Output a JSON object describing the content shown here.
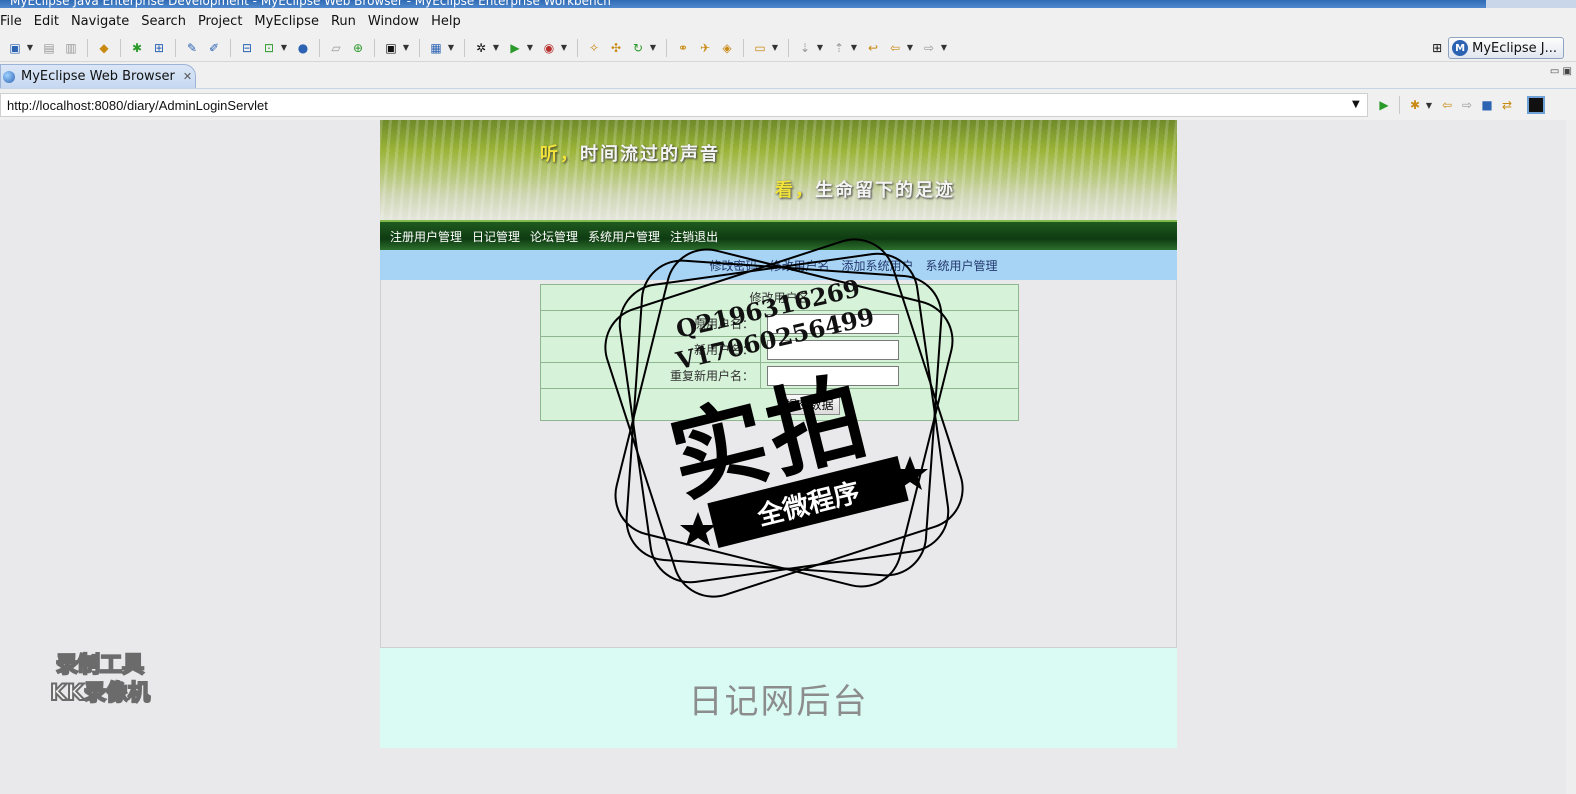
{
  "window": {
    "title": "MyEclipse Java Enterprise Development - MyEclipse Web Browser - MyEclipse Enterprise Workbench"
  },
  "menu": [
    "File",
    "Edit",
    "Navigate",
    "Search",
    "Project",
    "MyEclipse",
    "Run",
    "Window",
    "Help"
  ],
  "perspective": {
    "label": "MyEclipse J...",
    "logo": "M"
  },
  "editor_tab": {
    "label": "MyEclipse Web Browser",
    "close": "✕"
  },
  "address_bar": {
    "url": "http://localhost:8080/diary/AdminLoginServlet"
  },
  "web_page": {
    "banner": {
      "line1_accent": "听，",
      "line1": "时间流过的声音",
      "line2_accent": "看，",
      "line2": "生命留下的足迹"
    },
    "nav": [
      "注册用户管理",
      "日记管理",
      "论坛管理",
      "系统用户管理",
      "注销退出"
    ],
    "subnav": [
      "修改密码",
      "修改用户名",
      "添加系统用户",
      "系统用户管理"
    ],
    "form": {
      "header": "修改用户名",
      "field1_label": "原用户名：",
      "field2_label": "新用户名：",
      "field3_label": "重复新用户名：",
      "submit": "提交数据"
    },
    "footer": "日记网后台"
  },
  "stamp": {
    "line1": "Q2196316269",
    "line2": "V17060256499",
    "big": "实拍",
    "ribbon": "全微程序"
  },
  "recorder_watermark": {
    "line1": "录制工具",
    "line2": "KK录像机"
  },
  "icons": {
    "globe": "globe-icon",
    "run": "run-icon",
    "back": "back-arrow-icon",
    "forward": "forward-arrow-icon"
  }
}
